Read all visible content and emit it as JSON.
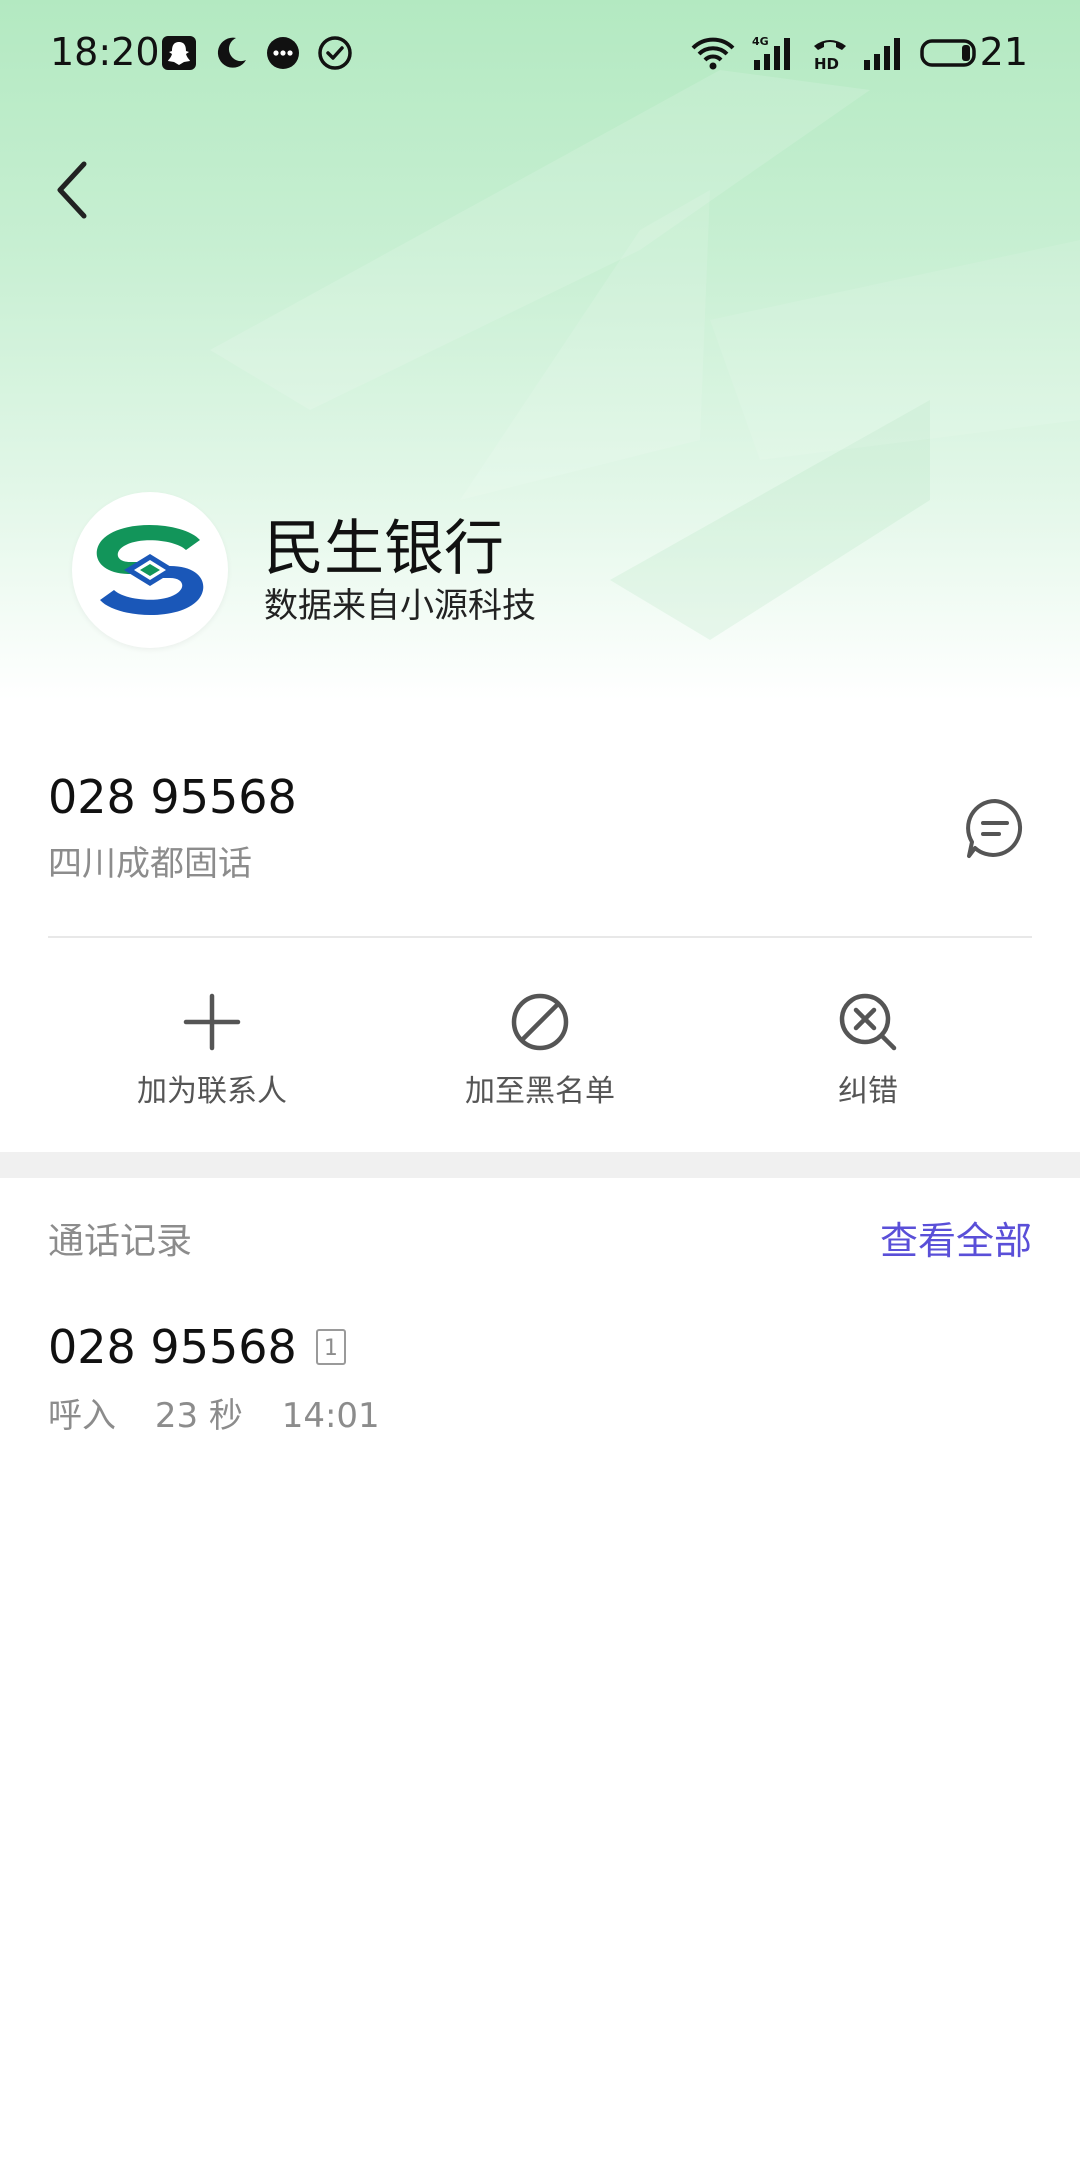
{
  "status_bar": {
    "time": "18:20",
    "battery_level": "21",
    "left_icons": [
      "snapchat-icon",
      "moon-icon",
      "chat-bubble-icon",
      "check-circle-icon"
    ],
    "right_icons": [
      "wifi-icon",
      "signal-4g-icon",
      "hd-call-icon",
      "signal-icon",
      "battery-icon"
    ]
  },
  "header": {
    "back_icon": "back-chevron-icon"
  },
  "contact": {
    "name": "民生银行",
    "source": "数据来自小源科技",
    "logo_icon": "minsheng-bank-logo"
  },
  "number_section": {
    "number": "028 95568",
    "location": "四川成都固话",
    "message_icon": "message-icon"
  },
  "actions": [
    {
      "label": "加为联系人",
      "icon": "plus-icon"
    },
    {
      "label": "加至黑名单",
      "icon": "block-icon"
    },
    {
      "label": "纠错",
      "icon": "search-close-icon"
    }
  ],
  "call_log": {
    "title": "通话记录",
    "view_all": "查看全部",
    "entries": [
      {
        "number": "028 95568",
        "sim": "1",
        "type": "呼入",
        "duration": "23 秒",
        "time": "14:01"
      }
    ]
  },
  "colors": {
    "accent": "#5a4fd8",
    "hero_green": "#b3e9c1",
    "bank_green": "#12955a",
    "bank_blue": "#1a57b8"
  }
}
